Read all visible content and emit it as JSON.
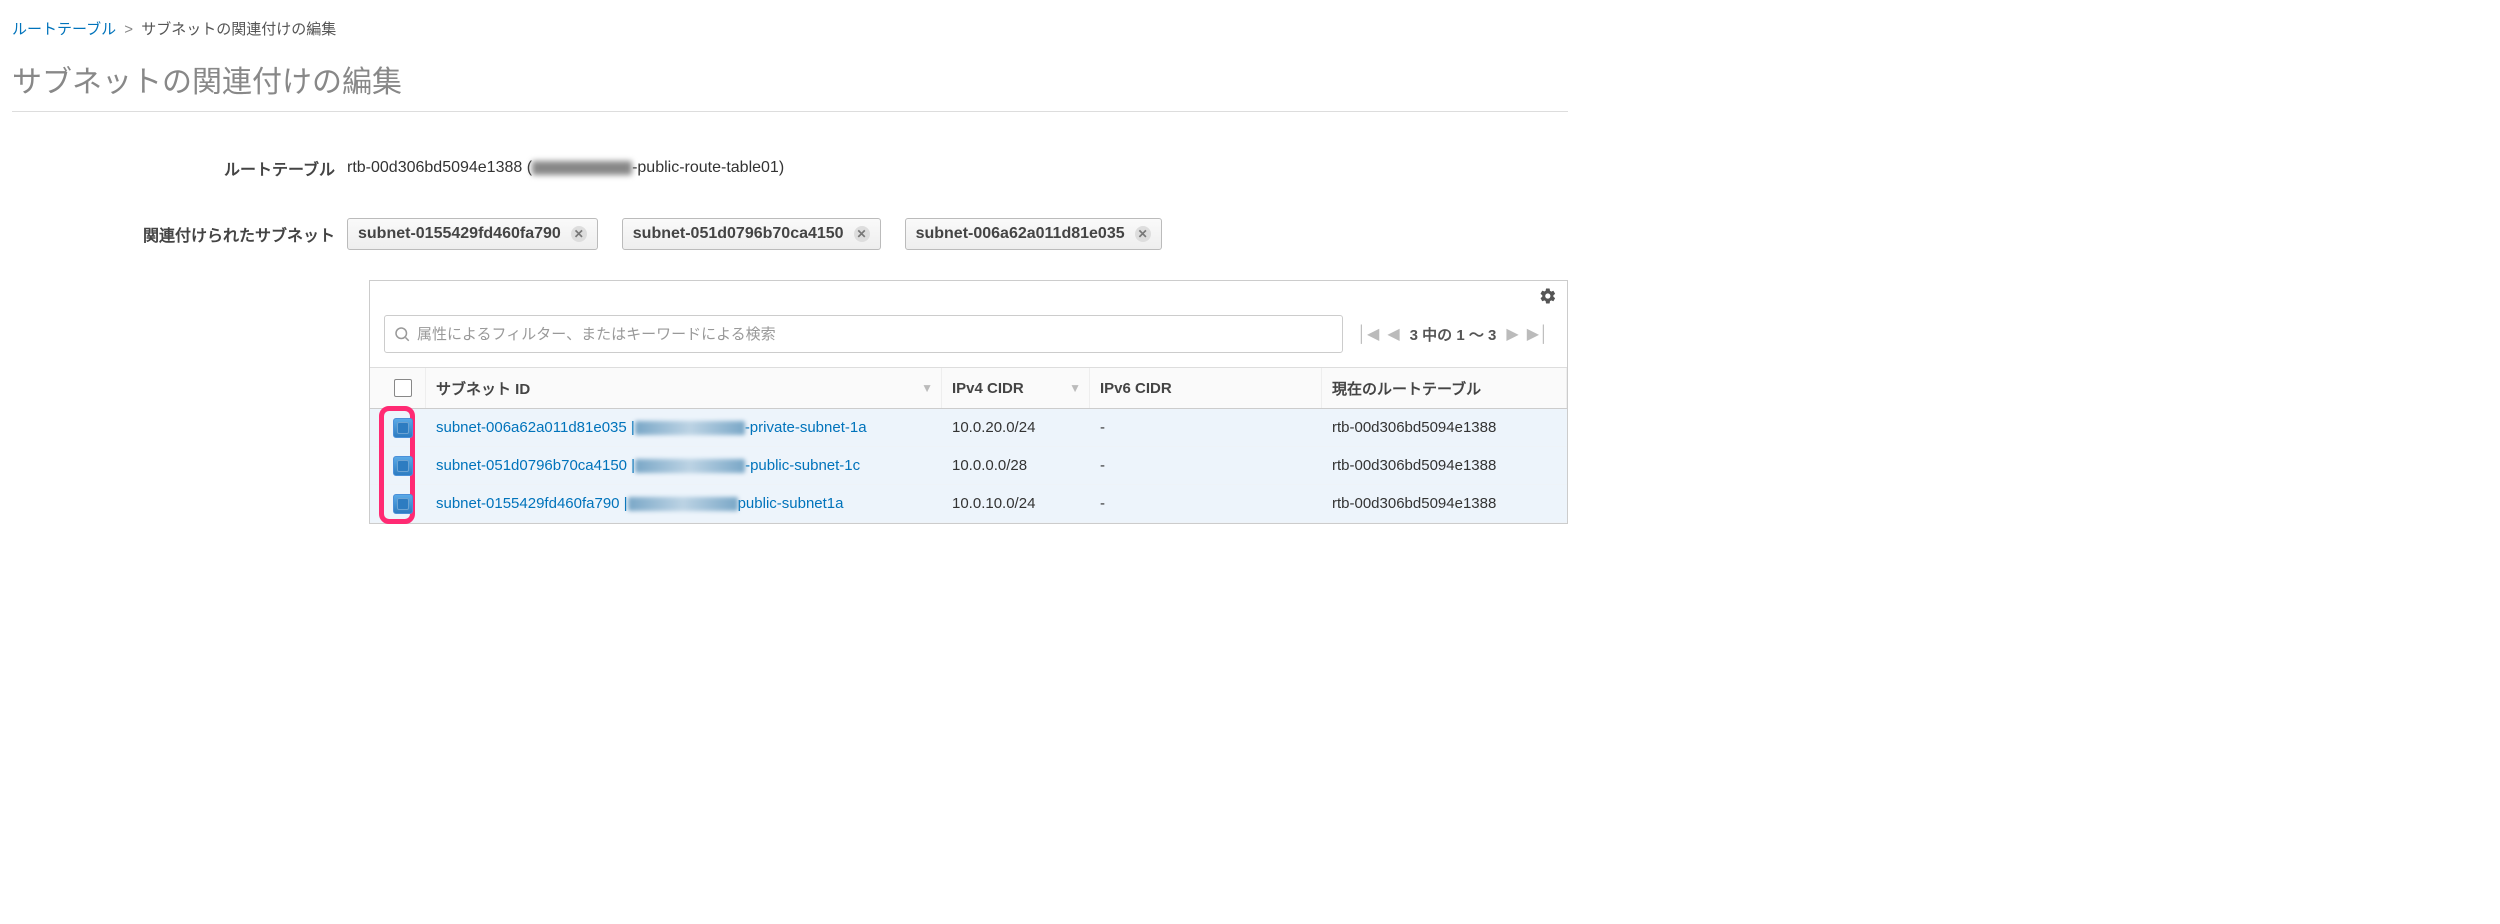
{
  "breadcrumb": {
    "root": "ルートテーブル",
    "sep": ">",
    "current": "サブネットの関連付けの編集"
  },
  "page_title": "サブネットの関連付けの編集",
  "meta": {
    "route_table_label": "ルートテーブル",
    "route_table_id": "rtb-00d306bd5094e1388",
    "route_table_name_prefix": "(",
    "route_table_name_suffix": "-public-route-table01)",
    "assoc_label": "関連付けられたサブネット"
  },
  "tags": [
    "subnet-0155429fd460fa790",
    "subnet-051d0796b70ca4150",
    "subnet-006a62a011d81e035"
  ],
  "search": {
    "placeholder": "属性によるフィルター、またはキーワードによる検索"
  },
  "pager": {
    "text": "3 中の 1 ～ 3"
  },
  "columns": {
    "subnet": "サブネット ID",
    "ipv4": "IPv4 CIDR",
    "ipv6": "IPv6 CIDR",
    "rt": "現在のルートテーブル"
  },
  "rows": [
    {
      "checked": true,
      "subnet_id": "subnet-006a62a011d81e035",
      "name_suffix": "-private-subnet-1a",
      "ipv4": "10.0.20.0/24",
      "ipv6": "-",
      "rt": "rtb-00d306bd5094e1388"
    },
    {
      "checked": true,
      "subnet_id": "subnet-051d0796b70ca4150",
      "name_suffix": "-public-subnet-1c",
      "ipv4": "10.0.0.0/28",
      "ipv6": "-",
      "rt": "rtb-00d306bd5094e1388"
    },
    {
      "checked": true,
      "subnet_id": "subnet-0155429fd460fa790",
      "name_suffix": "public-subnet1a",
      "ipv4": "10.0.10.0/24",
      "ipv6": "-",
      "rt": "rtb-00d306bd5094e1388"
    }
  ]
}
